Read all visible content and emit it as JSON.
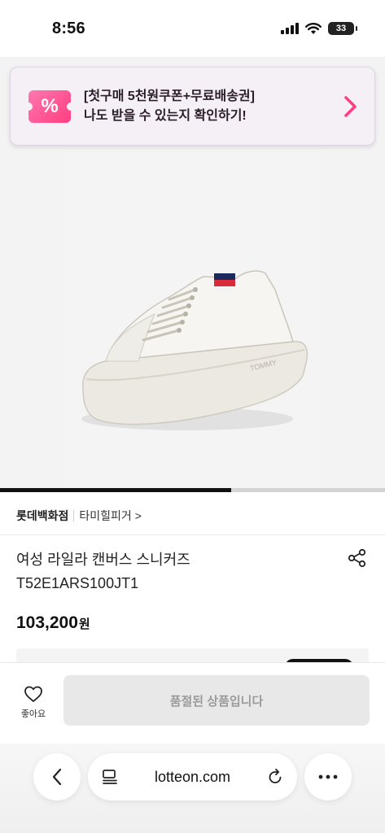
{
  "status_bar": {
    "time": "8:56",
    "battery": "33"
  },
  "promo_banner": {
    "icon_symbol": "%",
    "line1": "[첫구매 5천원쿠폰+무료배송권]",
    "line2": "나도 받을 수 있는지 확인하기!",
    "accent_color": "#ff3d7f"
  },
  "image_carousel": {
    "progress": 0.6
  },
  "breadcrumb": {
    "store": "롯데백화점",
    "brand": "타미힐피거 >"
  },
  "product": {
    "name_line1": "여성 라일라 캔버스 스니커즈",
    "name_line2": "T52E1ARS100JT1",
    "price": "103,200",
    "price_unit": "원"
  },
  "bottom_bar": {
    "wishlist_label": "좋아요",
    "soldout_label": "품절된 상품입니다"
  },
  "browser": {
    "url": "lotteon.com"
  }
}
